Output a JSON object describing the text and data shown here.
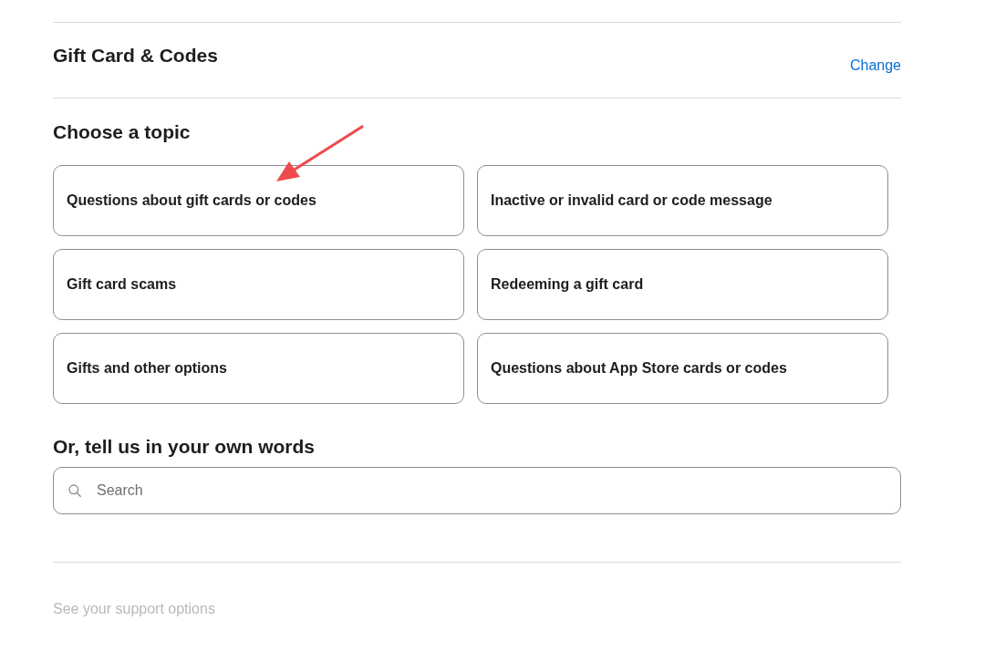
{
  "section": {
    "title": "Gift Card & Codes",
    "action": "Change"
  },
  "topics": {
    "heading": "Choose a topic",
    "items": [
      {
        "label": "Questions about gift cards or codes"
      },
      {
        "label": "Inactive or invalid card or code message"
      },
      {
        "label": "Gift card scams"
      },
      {
        "label": "Redeeming a gift card"
      },
      {
        "label": "Gifts and other options"
      },
      {
        "label": "Questions about App Store cards or codes"
      }
    ]
  },
  "search": {
    "heading": "Or, tell us in your own words",
    "placeholder": "Search"
  },
  "footer": {
    "link": "See your support options"
  }
}
